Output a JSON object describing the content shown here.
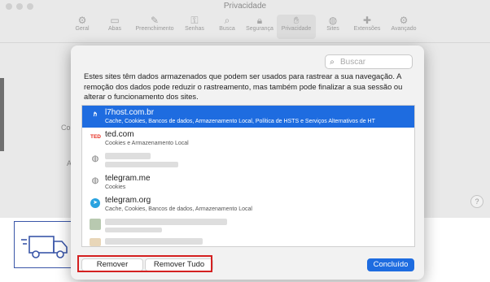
{
  "window": {
    "title": "Privacidade"
  },
  "toolbar": {
    "items": [
      {
        "label": "Geral",
        "icon": "gear-icon"
      },
      {
        "label": "Abas",
        "icon": "tabs-icon"
      },
      {
        "label": "Preenchimento",
        "icon": "autofill-icon"
      },
      {
        "label": "Senhas",
        "icon": "key-icon"
      },
      {
        "label": "Busca",
        "icon": "search-icon"
      },
      {
        "label": "Segurança",
        "icon": "lock-icon"
      },
      {
        "label": "Privacidade",
        "icon": "hand-icon",
        "active": true
      },
      {
        "label": "Sites",
        "icon": "globe-icon"
      },
      {
        "label": "Extensões",
        "icon": "puzzle-icon"
      },
      {
        "label": "Avançado",
        "icon": "advanced-gear-icon"
      }
    ]
  },
  "background": {
    "left_text_1": "Co",
    "left_text_2": "A",
    "help": "?"
  },
  "dialog": {
    "search_placeholder": "Buscar",
    "description": "Estes sites têm dados armazenados que podem ser usados para rastrear a sua navegação. A remoção dos dados pode reduzir o rastreamento, mas também pode finalizar a sua sessão ou alterar o funcionamento dos sites.",
    "sites": [
      {
        "name": "l7host.com.br",
        "detail": "Cache, Cookies, Bancos de dados, Armazenamento Local, Política de HSTS e Serviços Alternativos de HT",
        "icon": "l7host-favicon",
        "selected": true
      },
      {
        "name": "ted.com",
        "detail": "Cookies e Armazenamento Local",
        "icon": "ted-favicon"
      },
      {
        "name": "",
        "detail": "",
        "icon": "globe-icon",
        "blurred": true
      },
      {
        "name": "telegram.me",
        "detail": "Cookies",
        "icon": "globe-icon"
      },
      {
        "name": "telegram.org",
        "detail": "Cache, Cookies, Bancos de dados, Armazenamento Local",
        "icon": "telegram-favicon"
      }
    ],
    "buttons": {
      "remove": "Remover",
      "remove_all": "Remover Tudo",
      "done": "Concluído"
    }
  },
  "colors": {
    "accent": "#1e6ce0",
    "highlight_box": "#d42020"
  }
}
